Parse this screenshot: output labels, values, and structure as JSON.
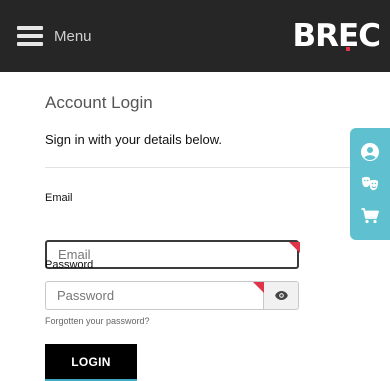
{
  "header": {
    "menu_label": "Menu",
    "logo_text": "BREC"
  },
  "login": {
    "title": "Account Login",
    "subtitle": "Sign in with your details below.",
    "email_label": "Email",
    "email_placeholder": "Email",
    "password_label": "Password",
    "password_placeholder": "Password",
    "forgot_link": "Forgotten your password?",
    "login_button": "LOGIN"
  },
  "side_panel": {
    "icons": [
      "account-icon",
      "theatre-masks-icon",
      "cart-icon"
    ]
  },
  "colors": {
    "header_bg": "#262626",
    "accent_teal": "#5fc1cf",
    "required_flag": "#e0344b",
    "button_bg": "#000000"
  }
}
